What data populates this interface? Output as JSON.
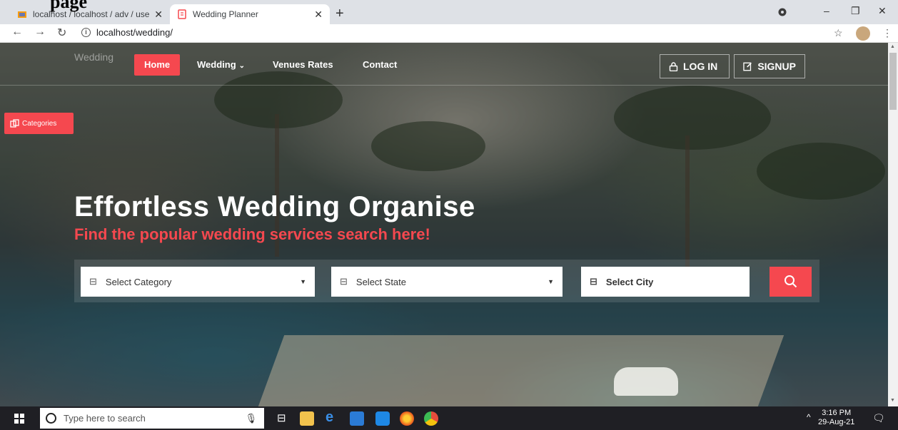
{
  "document": {
    "heading": "page"
  },
  "browser": {
    "tabs": [
      {
        "title": "localhost / localhost / adv / users",
        "active": false
      },
      {
        "title": "Wedding Planner",
        "active": true
      }
    ],
    "new_tab": "+",
    "url": "localhost/wedding/",
    "window_controls": {
      "minimize": "–",
      "restore": "❐",
      "close": "✕"
    }
  },
  "site": {
    "brand": "Wedding",
    "nav": {
      "home": "Home",
      "wedding": "Wedding",
      "venues": "Venues Rates",
      "contact": "Contact"
    },
    "auth": {
      "login": "LOG IN",
      "signup": "SIGNUP"
    },
    "categories_tab": "Categories",
    "hero": {
      "title": "Effortless Wedding Organise",
      "subtitle": "Find the popular wedding services search here!"
    },
    "search": {
      "category": "Select Category",
      "state": "Select State",
      "city": "Select City"
    }
  },
  "taskbar": {
    "search_placeholder": "Type here to search",
    "time": "3:16 PM",
    "date": "29-Aug-21"
  },
  "colors": {
    "accent": "#f5484f",
    "taskbar": "#1f1f24"
  }
}
